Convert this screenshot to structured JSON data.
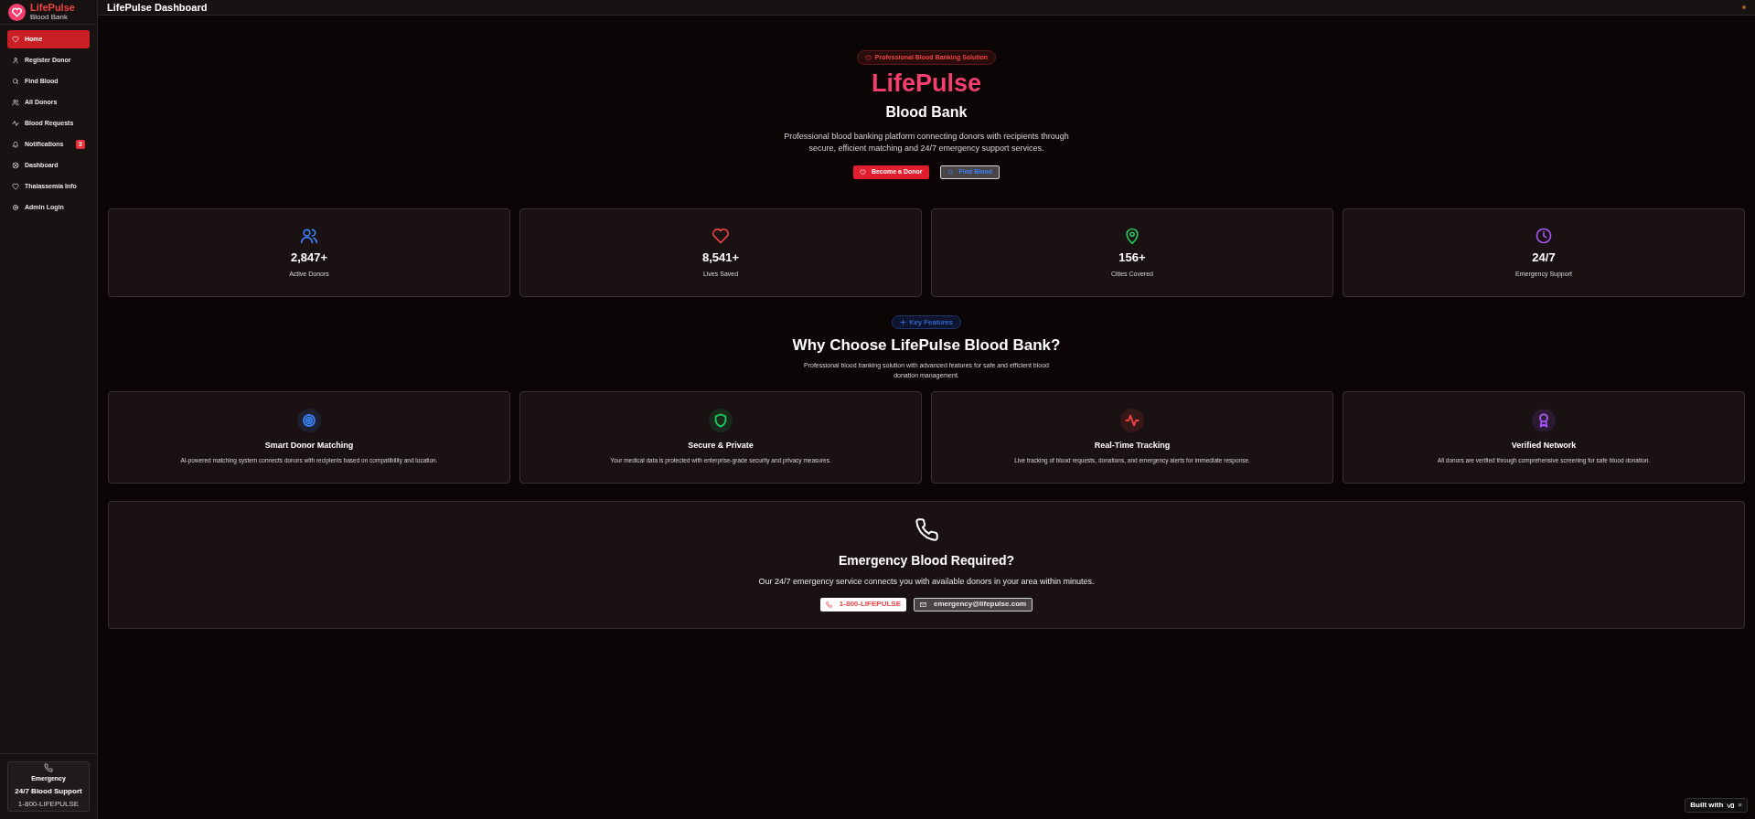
{
  "header": {
    "title": "LifePulse Dashboard"
  },
  "sidebar": {
    "brand": "LifePulse",
    "subtitle": "Blood Bank",
    "items": [
      {
        "label": "Home",
        "selected": true
      },
      {
        "label": "Register Donor",
        "selected": false
      },
      {
        "label": "Find Blood",
        "selected": false
      },
      {
        "label": "All Donors",
        "selected": false
      },
      {
        "label": "Blood Requests",
        "selected": false
      },
      {
        "label": "Notifications",
        "selected": false,
        "badge": "3"
      },
      {
        "label": "Dashboard",
        "selected": false
      },
      {
        "label": "Thalassemia Info",
        "selected": false
      },
      {
        "label": "Admin Login",
        "selected": false
      }
    ],
    "emergency": {
      "title": "Emergency",
      "subtitle": "24/7 Blood Support",
      "phone": "1-800-LIFEPULSE"
    }
  },
  "hero": {
    "badge": "Professional Blood Banking Solution",
    "title": "LifePulse",
    "subtitle": "Blood Bank",
    "description": "Professional blood banking platform connecting donors with recipients through secure, efficient matching and 24/7 emergency support services.",
    "primary_button": "Become a Donor",
    "secondary_button": "Find Blood"
  },
  "stats": [
    {
      "value": "2,847+",
      "label": "Active Donors",
      "color": "#3b82f6"
    },
    {
      "value": "8,541+",
      "label": "Lives Saved",
      "color": "#ef4444"
    },
    {
      "value": "156+",
      "label": "Cities Covered",
      "color": "#22c55e"
    },
    {
      "value": "24/7",
      "label": "Emergency Support",
      "color": "#a855f7"
    }
  ],
  "features_section": {
    "badge": "Key Features",
    "title": "Why Choose LifePulse Blood Bank?",
    "description": "Professional blood banking solution with advanced features for safe and efficient blood donation management."
  },
  "features": [
    {
      "title": "Smart Donor Matching",
      "description": "AI-powered matching system connects donors with recipients based on compatibility and location.",
      "color": "#3b82f6"
    },
    {
      "title": "Secure & Private",
      "description": "Your medical data is protected with enterprise-grade security and privacy measures.",
      "color": "#22c55e"
    },
    {
      "title": "Real-Time Tracking",
      "description": "Live tracking of blood requests, donations, and emergency alerts for immediate response.",
      "color": "#ef4444"
    },
    {
      "title": "Verified Network",
      "description": "All donors are verified through comprehensive screening for safe blood donation.",
      "color": "#a855f7"
    }
  ],
  "emergency": {
    "title": "Emergency Blood Required?",
    "description": "Our 24/7 emergency service connects you with available donors in your area within minutes.",
    "phone": "1-800-LIFEPULSE",
    "email": "emergency@lifepulse.com"
  },
  "built_with": {
    "label": "Built with",
    "close": "×"
  }
}
